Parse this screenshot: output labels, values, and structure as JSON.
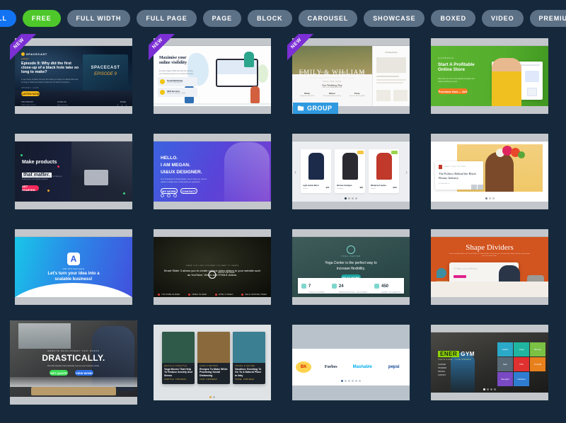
{
  "filters": [
    {
      "label": "ALL",
      "state": "active-blue"
    },
    {
      "label": "FREE",
      "state": "active-green"
    },
    {
      "label": "FULL WIDTH",
      "state": "default"
    },
    {
      "label": "FULL PAGE",
      "state": "default"
    },
    {
      "label": "PAGE",
      "state": "default"
    },
    {
      "label": "BLOCK",
      "state": "default"
    },
    {
      "label": "CAROUSEL",
      "state": "default"
    },
    {
      "label": "SHOWCASE",
      "state": "default"
    },
    {
      "label": "BOXED",
      "state": "default"
    },
    {
      "label": "VIDEO",
      "state": "default"
    },
    {
      "label": "PREMIUM",
      "state": "default"
    }
  ],
  "badges": {
    "new_label": "NEW",
    "group_label": "GROUP",
    "group_icon": "folder-icon"
  },
  "cards": {
    "c1": {
      "brand": "SPACECAST",
      "subtitle": "podcast",
      "heading": "Episode 9: Why did the first close-up of a black hole take so long to make?",
      "body": "A new study explains how the first close-up image of a black hole took so long to make and what it means for the future of science.",
      "meta": "EPISODE 9 · 42 MIN",
      "cta": "LISTEN NOW",
      "art_title": "SPACECAST",
      "art_sub": "EPISODE 9",
      "foot_left": "THE PODCAST",
      "foot_left_sub": "SPACECAST SHOW",
      "foot_mid": "LISTEN ON",
      "foot_mid_sub": "Apple Podcasts",
      "foot_right": "SHARE"
    },
    "c2": {
      "heading": "Maximise your online visibility",
      "body": "Increase organic traffic with ads and enhance your business presence on social media sites.",
      "feature1_title": "Social Marketing",
      "feature1_sub": "Get 24/7 paid growth",
      "feature2_title": "SEO Services",
      "feature2_sub": "Rank your website in traffic"
    },
    "c3": {
      "names": "EMILY & WILLIAM",
      "date": "WE ARE GETTING MARRIED · 09.24.2022",
      "nav": [
        "HOME",
        "STORY",
        "GALLERY",
        "RSVP"
      ],
      "section_kicker": "SAVE THE DATE",
      "section_title": "Our Wedding Day",
      "section_sub": "Join us to celebrate our love",
      "col1": "When",
      "col1_sub": "September 24th 2022",
      "col2": "Where",
      "col2_sub": "Rosewood Gardens Estate",
      "col3": "Party",
      "col3_sub": "Dinner & Dancing 6PM",
      "side_title": "Wedding Details"
    },
    "c4": {
      "kicker": "ECOMMERCE",
      "heading": "Start A Profitable Online Store",
      "body": "Start with one of our most popular templates and design anything you want.",
      "cta": "Purchase Now — $29"
    },
    "c5": {
      "heading_line1": "Make products",
      "heading_line2": "that matter.",
      "body": "We provide digital marketing services to help you build great, bold digital products.",
      "cta": "GET STARTED"
    },
    "c6": {
      "line1": "HELLO.",
      "line2": "I AM MEGAN.",
      "line3": "UI&UX DESIGNER.",
      "body": "I'm a UI designer & visual designer, nice to meet you. I love & explore to design how I create great user experience.",
      "cta1": "MY WORK",
      "cta2": "CONTACT"
    },
    "c7": {
      "products": [
        {
          "name": "Light Jacket Men's",
          "category": "Jackets",
          "price": "$78"
        },
        {
          "name": "Woman Cardigan",
          "category": "Cardigans",
          "price": "$62",
          "badge": "SALE"
        },
        {
          "name": "Windproof Jacket",
          "category": "Jackets",
          "price": "$115",
          "badge": "NEW"
        }
      ],
      "prev": "‹",
      "next": "›"
    },
    "c8": {
      "kicker": "BEAUTY AND CULTURE",
      "title": "The Politics Behind the Black Beauty Industry",
      "meta": "BY MIA WELLS"
    },
    "c9": {
      "kicker": "Hello, We're Super Agency",
      "line1": "Let's turn your idea into a",
      "line2": "scalable business!",
      "cta": "GET STARTED",
      "logo": "A"
    },
    "c10": {
      "kicker": "THERE IS NO LIMIT FOR WHAT YOU WANT TO CREATE",
      "body": "Smart Slider 3 allows you to create various video sliders to your website such as YouTube, Vimeo and HTML5 videos.",
      "cta": "WATCH THE VIDEO",
      "thumbs": [
        "YOUTUBE SLIDER",
        "VIMEO SLIDER",
        "HTML 5 VIDEO",
        "SELF HOSTED VIDEO"
      ]
    },
    "c11": {
      "brand": "YOGA CENTER",
      "heading_line1": "Yoga Center is the perfect way to",
      "heading_line2": "increase flexibility.",
      "cta": "READ MORE",
      "stats": [
        {
          "value": "7",
          "label": "YOGA CLASSES",
          "icon": "yoga-icon"
        },
        {
          "value": "24",
          "label": "PROFESSIONAL TEACHERS",
          "icon": "teacher-icon"
        },
        {
          "value": "450",
          "label": "HAPPY STUDENTS",
          "icon": "thumbs-up-icon"
        }
      ]
    },
    "c12": {
      "title": "Shape Dividers",
      "body": "Create beautiful sliders with Smart Slider 3's shape dividers and make your site look truly unique with the many shapes you can choose from.",
      "shop_title": "A chair you will love",
      "shop_cta": "SHOP NOW"
    },
    "c13": {
      "kicker": "WEBSITE DEVELOPMENT THAT WORKS",
      "title": "DRASTICALLY.",
      "body": "We build websites that drastically improve your business results.",
      "cta1": "GET QUOTE",
      "cta2": "VIEW WORK"
    },
    "c14": {
      "posts": [
        {
          "kicker": "HEALTH & LIFESTYLE",
          "title": "Yoga Moves That Help To Reduce Anxiety And Stress",
          "meta": "LIFESTYLE · 5 MIN READ",
          "tint": "#2f5a4a"
        },
        {
          "kicker": "FOOD & RECIPES",
          "title": "Recipes To Make While Practicing Social Distancing",
          "meta": "FOOD · 8 MIN READ",
          "tint": "#8a6a3c"
        },
        {
          "kicker": "TRAVEL & NATURE",
          "title": "Vacation: Deciding To Go To A Natural Place In Italy",
          "meta": "TRAVEL · 6 MIN READ",
          "tint": "#3a7f92"
        }
      ]
    },
    "c15": {
      "logos": [
        {
          "name": "Burger King",
          "short": "BK",
          "color": "#d62300"
        },
        {
          "name": "Forbes",
          "short": "Forbes",
          "color": "#13233c"
        },
        {
          "name": "Mashable",
          "short": "Mashable",
          "color": "#00aeef"
        },
        {
          "name": "Pepsi",
          "short": "pepsi",
          "color": "#0e4595"
        }
      ]
    },
    "c16": {
      "brand_1": "ENER",
      "brand_2": "GYM",
      "tagline": "TRAIN HARD · LIVE STRONG",
      "menu": [
        "CLASSES",
        "TRAINERS",
        "PRICING",
        "CONTACT"
      ],
      "tiles": [
        {
          "label": "Cardio",
          "color": "#2aa9c9"
        },
        {
          "label": "Yoga",
          "color": "#1fb5a0"
        },
        {
          "label": "Boxing",
          "color": "#7ac144"
        },
        {
          "label": "Spin",
          "color": "#5a6b77"
        },
        {
          "label": "TRX",
          "color": "#e03030"
        },
        {
          "label": "Crossfit",
          "color": "#e8801c"
        },
        {
          "label": "Strength",
          "color": "#7a49c4"
        },
        {
          "label": "Nutrition",
          "color": "#2f7dd1"
        }
      ]
    }
  },
  "colors": {
    "page_bg": "#16293c",
    "pill_default": "#5d7186",
    "pill_all": "#1273f3",
    "pill_free": "#4ec72b",
    "ribbon": "#7b2fd4",
    "group_badge": "#2f9ae0"
  }
}
